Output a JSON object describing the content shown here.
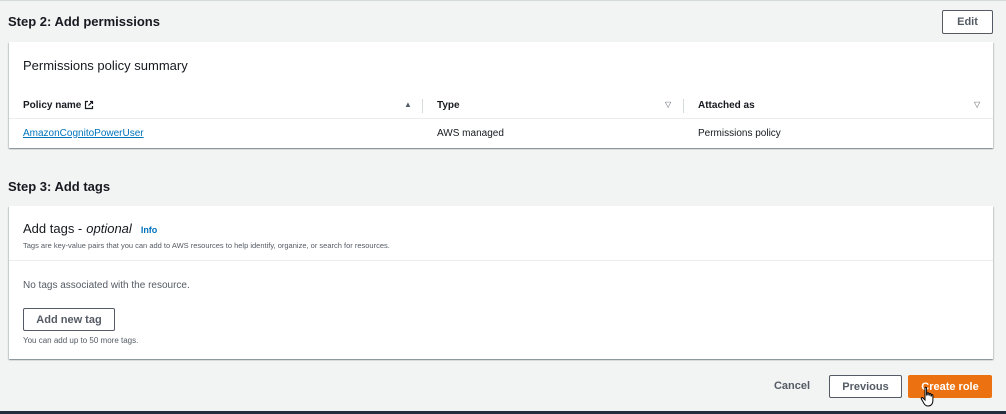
{
  "step2": {
    "title": "Step 2: Add permissions",
    "edit_label": "Edit",
    "panel_title": "Permissions policy summary",
    "table": {
      "columns": [
        {
          "label": "Policy name",
          "sort": "▲",
          "icon": "external-link-icon"
        },
        {
          "label": "Type",
          "sort": "▽"
        },
        {
          "label": "Attached as",
          "sort": "▽"
        }
      ],
      "rows": [
        {
          "policy_name": "AmazonCognitoPowerUser",
          "type": "AWS managed",
          "attached_as": "Permissions policy"
        }
      ]
    }
  },
  "step3": {
    "title": "Step 3: Add tags",
    "panel_title_main": "Add tags -",
    "panel_title_optional": "optional",
    "info_label": "Info",
    "description": "Tags are key-value pairs that you can add to AWS resources to help identify, organize, or search for resources.",
    "empty_text": "No tags associated with the resource.",
    "add_tag_label": "Add new tag",
    "limit_text": "You can add up to 50 more tags."
  },
  "footer": {
    "cancel_label": "Cancel",
    "previous_label": "Previous",
    "create_label": "Create role"
  },
  "colors": {
    "primary": "#ec7211",
    "link": "#0073bb"
  },
  "icons": {
    "cursor": "hand-pointer-icon"
  }
}
